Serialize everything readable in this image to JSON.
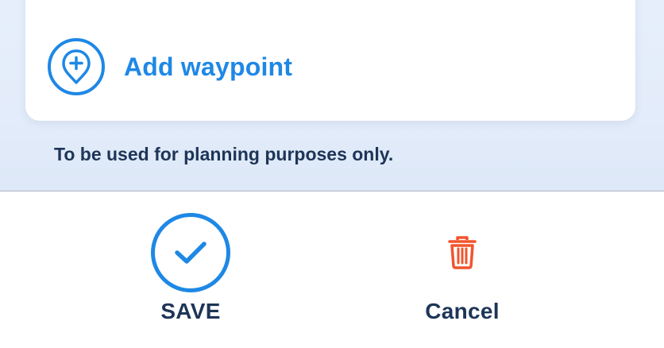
{
  "waypoint": {
    "add_label": "Add waypoint",
    "icon": "map-pin-plus-icon"
  },
  "disclaimer": "To be used for planning purposes only.",
  "actions": {
    "save_label": "SAVE",
    "save_icon": "checkmark-icon",
    "cancel_label": "Cancel",
    "cancel_icon": "trash-icon"
  },
  "colors": {
    "accent": "#1e88e5",
    "danger": "#f2542d",
    "text_dark": "#1d3557",
    "panel_bg": "#e6eefb"
  }
}
